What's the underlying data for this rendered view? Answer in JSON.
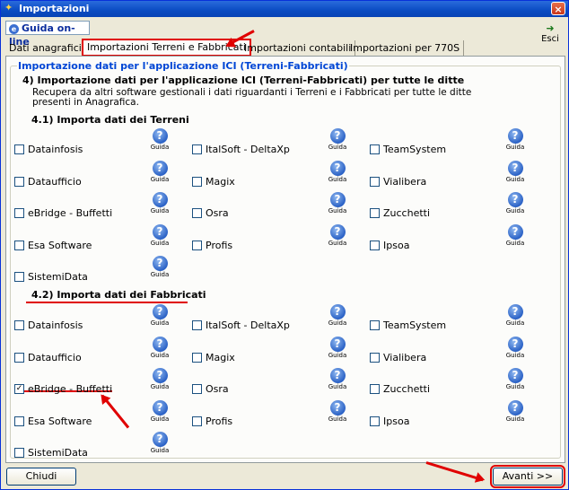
{
  "window": {
    "title": "Importazioni",
    "close_glyph": "×"
  },
  "toolbar": {
    "guida_online": "Guida on-line",
    "esci": "Esci"
  },
  "tabs": [
    {
      "label": "Dati anagrafici"
    },
    {
      "label": "Importazioni Terreni e Fabbricati"
    },
    {
      "label": "Importazioni contabili"
    },
    {
      "label": "Importazioni per 770S"
    }
  ],
  "group": {
    "title": "Importazione dati per l'applicazione ICI (Terreni-Fabbricati)",
    "heading": "4) Importazione dati per l'applicazione ICI (Terreni-Fabbricati) per tutte le ditte",
    "description": "Recupera da altri software gestionali i dati riguardanti i Terreni e i Fabbricati per tutte le ditte presenti in Anagrafica.",
    "section1": "4.1) Importa dati dei Terreni",
    "section2": "4.2) Importa dati dei Fabbricati"
  },
  "guida_label": "Guida",
  "help_glyph": "?",
  "terreni": [
    {
      "label": "Datainfosis",
      "checked": false
    },
    {
      "label": "ItalSoft - DeltaXp",
      "checked": false
    },
    {
      "label": "TeamSystem",
      "checked": false
    },
    {
      "label": "Dataufficio",
      "checked": false
    },
    {
      "label": "Magix",
      "checked": false
    },
    {
      "label": "Vialibera",
      "checked": false
    },
    {
      "label": "eBridge - Buffetti",
      "checked": false
    },
    {
      "label": "Osra",
      "checked": false
    },
    {
      "label": "Zucchetti",
      "checked": false
    },
    {
      "label": "Esa Software",
      "checked": false
    },
    {
      "label": "Profis",
      "checked": false
    },
    {
      "label": "Ipsoa",
      "checked": false
    },
    {
      "label": "SistemiData",
      "checked": false
    }
  ],
  "fabbricati": [
    {
      "label": "Datainfosis",
      "checked": false
    },
    {
      "label": "ItalSoft - DeltaXp",
      "checked": false
    },
    {
      "label": "TeamSystem",
      "checked": false
    },
    {
      "label": "Dataufficio",
      "checked": false
    },
    {
      "label": "Magix",
      "checked": false
    },
    {
      "label": "Vialibera",
      "checked": false
    },
    {
      "label": "eBridge - Buffetti",
      "checked": true
    },
    {
      "label": "Osra",
      "checked": false
    },
    {
      "label": "Zucchetti",
      "checked": false
    },
    {
      "label": "Esa Software",
      "checked": false
    },
    {
      "label": "Profis",
      "checked": false
    },
    {
      "label": "Ipsoa",
      "checked": false
    },
    {
      "label": "SistemiData",
      "checked": false
    }
  ],
  "buttons": {
    "chiudi": "Chiudi",
    "avanti": "Avanti >>"
  },
  "colors": {
    "annotation": "#e00000",
    "group_title": "#0046d5"
  }
}
